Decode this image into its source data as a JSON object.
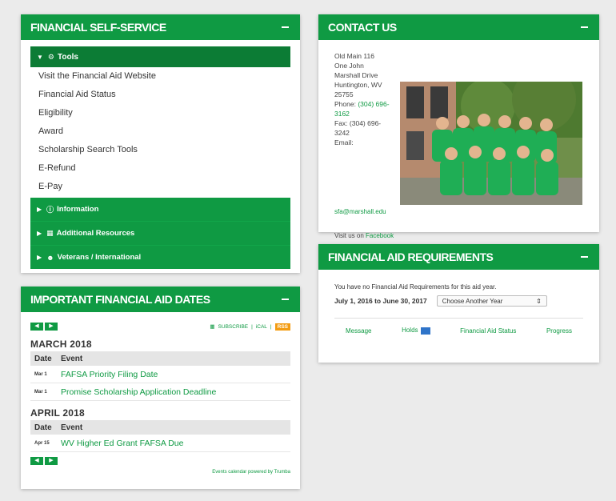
{
  "fss": {
    "title": "FINANCIAL SELF-SERVICE",
    "tools_label": "Tools",
    "tools_items": [
      "Visit the Financial Aid Website",
      "Financial Aid Status",
      "Eligibility",
      "Award",
      "Scholarship Search Tools",
      "E-Refund",
      "E-Pay"
    ],
    "sections": [
      "Information",
      "Additional Resources",
      "Veterans / International"
    ]
  },
  "dates": {
    "title": "IMPORTANT FINANCIAL AID DATES",
    "subscribe": "SUBSCRIBE",
    "ical": "iCAL",
    "rss": "RSS",
    "col_date": "Date",
    "col_event": "Event",
    "months": [
      {
        "name": "MARCH 2018",
        "events": [
          {
            "date": "Mar 1",
            "event": "FAFSA Priority Filing Date"
          },
          {
            "date": "Mar 1",
            "event": "Promise Scholarship Application Deadline"
          }
        ]
      },
      {
        "name": "APRIL 2018",
        "events": [
          {
            "date": "Apr 15",
            "event": "WV Higher Ed Grant FAFSA Due"
          }
        ]
      }
    ],
    "powered": "Events calendar powered by Trumba"
  },
  "contact": {
    "title": "CONTACT US",
    "address_lines": [
      "Old Main 116",
      "One John",
      "Marshall Drive",
      "Huntington, WV",
      "25755"
    ],
    "phone_label": "Phone:",
    "phone": "(304) 696-3162",
    "fax_label": "Fax:",
    "fax": "(304) 696-3242",
    "email_label": "Email:",
    "email": "sfa@marshall.edu",
    "visit_prefix": "Visit us on",
    "visit_link": "Facebook"
  },
  "req": {
    "title": "FINANCIAL AID REQUIREMENTS",
    "message": "You have no Financial Aid Requirements for this aid year.",
    "date_range": "July 1, 2016 to June 30, 2017",
    "select_value": "Choose Another Year",
    "tabs": [
      "Message",
      "Holds",
      "Financial Aid Status",
      "Progress"
    ]
  }
}
